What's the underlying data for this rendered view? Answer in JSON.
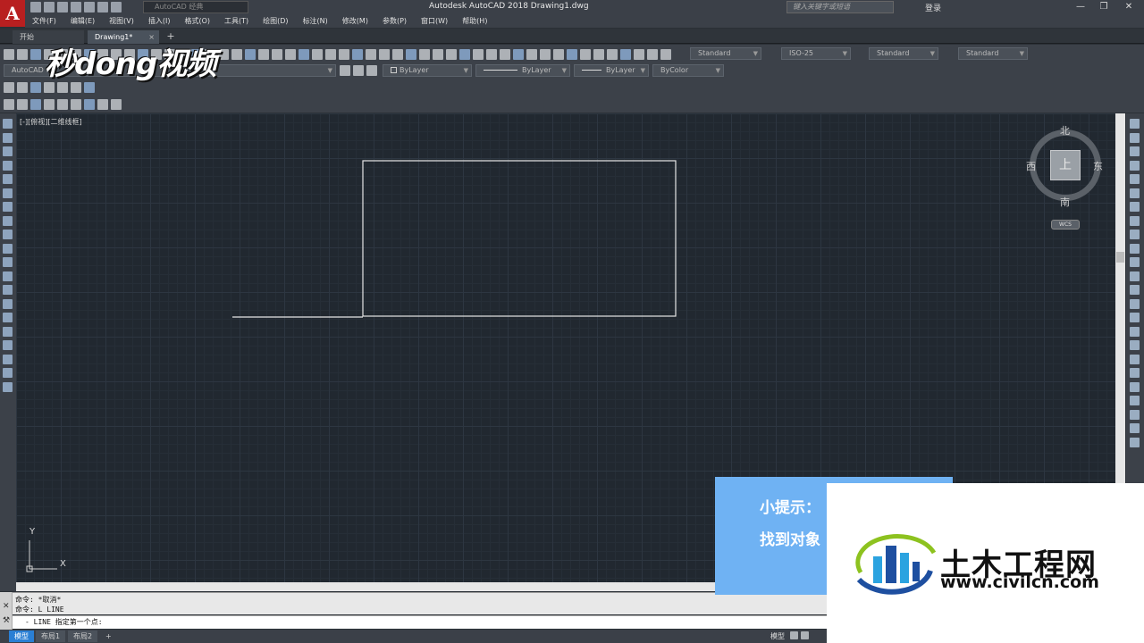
{
  "window": {
    "app_letter": "A",
    "title": "Autodesk AutoCAD 2018    Drawing1.dwg",
    "workspace": "AutoCAD 经典",
    "search_placeholder": "键入关键字或短语",
    "login": "登录",
    "minimize": "—",
    "restore": "❐",
    "close": "✕"
  },
  "menu": [
    "文件(F)",
    "编辑(E)",
    "视图(V)",
    "插入(I)",
    "格式(O)",
    "工具(T)",
    "绘图(D)",
    "标注(N)",
    "修改(M)",
    "参数(P)",
    "窗口(W)",
    "帮助(H)"
  ],
  "tabs": {
    "start": "开始",
    "drawing": "Drawing1*",
    "close": "×",
    "add": "+"
  },
  "toolbar": {
    "text_style": "Standard",
    "dim_style": "ISO-25",
    "table_style": "Standard",
    "multileader_style": "Standard",
    "layer_label": "AutoCAD",
    "color": "ByLayer",
    "linetype": "ByLayer",
    "lineweight": "ByLayer",
    "plot_style": "ByColor"
  },
  "watermark_top": "秒dong视频",
  "viewport": {
    "label": "[-][俯视][二维线框]",
    "viewcube_top": "上",
    "north": "北",
    "south": "南",
    "east": "东",
    "west": "西",
    "wcs": "WCS",
    "ucs_x": "X",
    "ucs_y": "Y"
  },
  "tip": {
    "line1": "小提示：",
    "line2": "找到对象"
  },
  "brand": {
    "name": "土木工程网",
    "url": "www.civilcn.com",
    "colors": {
      "blue": "#1e4fa0",
      "cyan": "#2ba3e0",
      "green": "#8dc21f"
    }
  },
  "command": {
    "history": [
      "命令: *取消*",
      "命令: L LINE"
    ],
    "prompt": "- LINE 指定第一个点:"
  },
  "status": {
    "tabs": [
      "模型",
      "布局1",
      "布局2"
    ],
    "add": "+",
    "model": "模型"
  }
}
